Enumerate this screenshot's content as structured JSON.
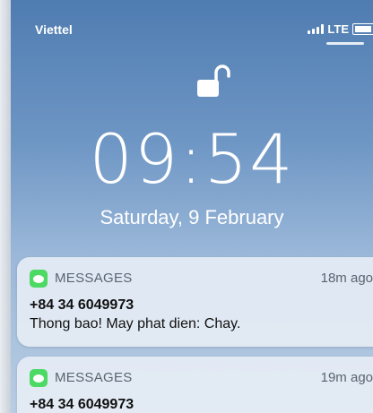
{
  "status_bar": {
    "carrier": "Viettel",
    "network": "LTE"
  },
  "lockscreen": {
    "time": "09:54",
    "date": "Saturday, 9 February"
  },
  "notifications": [
    {
      "app": "MESSAGES",
      "time": "18m ago",
      "sender": "+84 34 6049973",
      "body": "Thong bao! May phat dien: Chay."
    },
    {
      "app": "MESSAGES",
      "time": "19m ago",
      "sender": "+84 34 6049973"
    }
  ],
  "colors": {
    "messages_icon": "#4cd964",
    "wallpaper_top": "#4f7cb1"
  }
}
